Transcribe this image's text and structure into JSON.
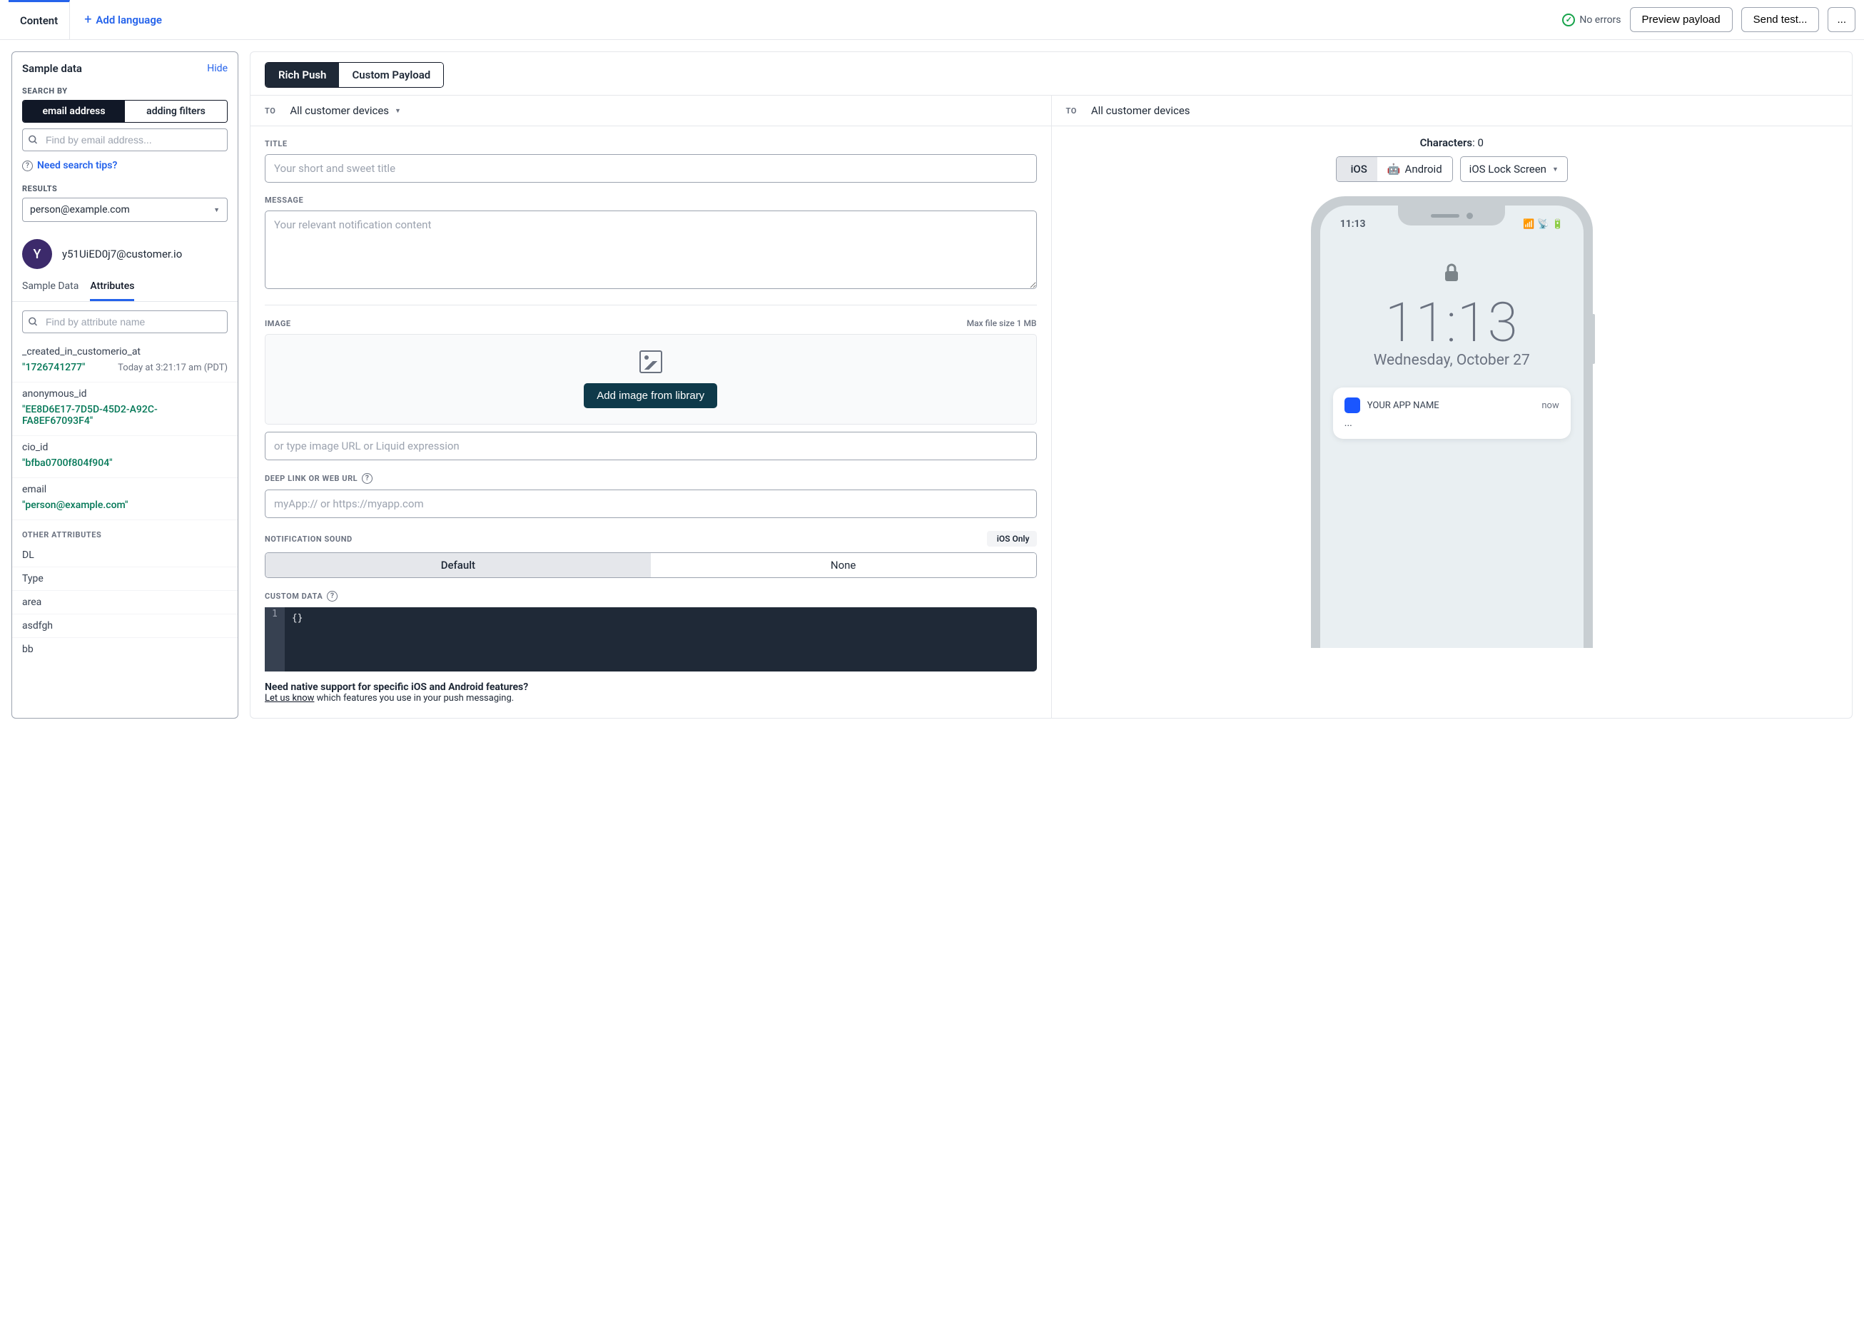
{
  "top": {
    "tab": "Content",
    "add_language": "Add language",
    "no_errors": "No errors",
    "preview_payload": "Preview payload",
    "send_test": "Send test...",
    "more": "..."
  },
  "left": {
    "title": "Sample data",
    "hide": "Hide",
    "search_by_label": "SEARCH BY",
    "seg_email": "email address",
    "seg_filters": "adding filters",
    "find_placeholder": "Find by email address...",
    "tips": "Need search tips?",
    "results_label": "RESULTS",
    "results_value": "person@example.com",
    "avatar_letter": "Y",
    "profile_email": "y51UiED0j7@customer.io",
    "subtab_sample": "Sample Data",
    "subtab_attr": "Attributes",
    "attr_search_placeholder": "Find by attribute name",
    "attrs": [
      {
        "key": "_created_in_customerio_at",
        "val": "\"1726741277\"",
        "note": "Today at 3:21:17 am (PDT)"
      },
      {
        "key": "anonymous_id",
        "val": "\"EE8D6E17-7D5D-45D2-A92C-FA8EF67093F4\""
      },
      {
        "key": "cio_id",
        "val": "\"bfba0700f804f904\""
      },
      {
        "key": "email",
        "val": "\"person@example.com\""
      }
    ],
    "other_label": "OTHER ATTRIBUTES",
    "other_attrs": [
      "DL",
      "Type",
      "area",
      "asdfgh",
      "bb"
    ]
  },
  "pills": {
    "rich": "Rich Push",
    "custom": "Custom Payload"
  },
  "form": {
    "to_label": "TO",
    "to_value": "All customer devices",
    "title_label": "TITLE",
    "title_placeholder": "Your short and sweet title",
    "message_label": "MESSAGE",
    "message_placeholder": "Your relevant notification content",
    "image_label": "IMAGE",
    "max_size": "Max file size 1 MB",
    "add_image_btn": "Add image from library",
    "image_url_placeholder": "or type image URL or Liquid expression",
    "deeplink_label": "DEEP LINK OR WEB URL",
    "deeplink_placeholder": "myApp:// or https://myapp.com",
    "sound_label": "NOTIFICATION SOUND",
    "ios_only": "iOS Only",
    "sound_default": "Default",
    "sound_none": "None",
    "custom_data_label": "CUSTOM DATA",
    "code_line": "1",
    "code_content": "{}",
    "native_q": "Need native support for specific iOS and Android features?",
    "let_us_know": "Let us know",
    "native_rest": " which features you use in your push messaging."
  },
  "preview": {
    "to_label": "TO",
    "to_value": "All customer devices",
    "chars_label": "Characters",
    "chars_value": "0",
    "os_ios": "iOS",
    "os_android": "Android",
    "screen_select": "iOS Lock Screen",
    "status_time": "11:13",
    "big_time": "11:13",
    "big_date": "Wednesday, October 27",
    "notif_app": "YOUR APP NAME",
    "notif_time": "now",
    "notif_body": "..."
  }
}
